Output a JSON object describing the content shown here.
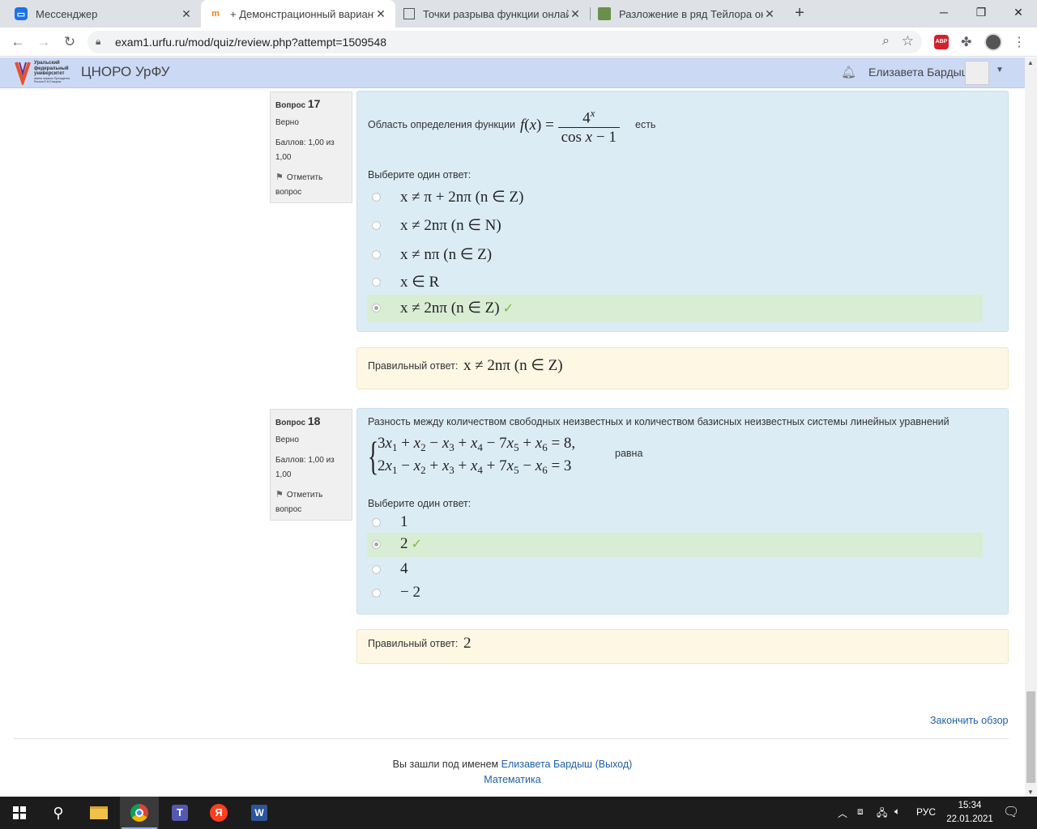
{
  "browser": {
    "tabs": [
      {
        "title": "Мессенджер",
        "icon": "messenger-icon"
      },
      {
        "title": "+ Демонстрационный вариант",
        "icon": "moodle-icon"
      },
      {
        "title": "Точки разрыва функции онлайн",
        "icon": "page-icon"
      },
      {
        "title": "Разложение в ряд Тейлора онлайн",
        "icon": "landscape-icon"
      }
    ],
    "url": "exam1.urfu.ru/mod/quiz/review.php?attempt=1509548"
  },
  "header": {
    "site_name": "ЦНОРО УрФУ",
    "logo_text": "Уральский федеральный университет",
    "logo_subtext": "имени первого Президента России Б.Н.Ельцина",
    "user_name": "Елизавета Бардыш"
  },
  "questions": [
    {
      "label": "Вопрос",
      "number": "17",
      "state": "Верно",
      "points": "Баллов: 1,00 из 1,00",
      "flag": "Отметить вопрос",
      "text_before": "Область определения функции",
      "text_after": "есть",
      "prompt": "Выберите один ответ:",
      "options": [
        {
          "text": "x ≠ π + 2nπ  (n ∈ Z)",
          "selected": false,
          "correct": false
        },
        {
          "text": "x ≠ 2nπ  (n ∈ N)",
          "selected": false,
          "correct": false
        },
        {
          "text": "x ≠ nπ  (n ∈ Z)",
          "selected": false,
          "correct": false
        },
        {
          "text": "x ∈ R",
          "selected": false,
          "correct": false
        },
        {
          "text": "x ≠ 2nπ  (n ∈ Z)",
          "selected": true,
          "correct": true
        }
      ],
      "right_answer_label": "Правильный ответ:",
      "right_answer": "x ≠ 2nπ  (n ∈ Z)"
    },
    {
      "label": "Вопрос",
      "number": "18",
      "state": "Верно",
      "points": "Баллов: 1,00 из 1,00",
      "flag": "Отметить вопрос",
      "text_before": "Разность между количеством свободных неизвестных и количеством базисных неизвестных системы линейных уравнений",
      "text_after": "равна",
      "prompt": "Выберите один ответ:",
      "options": [
        {
          "text": "1",
          "selected": false,
          "correct": false
        },
        {
          "text": "2",
          "selected": true,
          "correct": true
        },
        {
          "text": "4",
          "selected": false,
          "correct": false
        },
        {
          "text": "− 2",
          "selected": false,
          "correct": false
        }
      ],
      "right_answer_label": "Правильный ответ:",
      "right_answer": "2"
    }
  ],
  "footer": {
    "finish_review": "Закончить обзор",
    "logged_in_as": "Вы зашли под именем",
    "user_link": "Елизавета Бардыш",
    "logout": "(Выход)",
    "course": "Математика"
  },
  "taskbar": {
    "language": "РУС",
    "time": "15:34",
    "date": "22.01.2021"
  },
  "colors": {
    "header_bg": "#cbd9f5",
    "question_bg": "#dcecf5",
    "outcome_bg": "#fdf7e4",
    "correct_bg": "#d9ecd4",
    "link": "#1f5fa8"
  }
}
